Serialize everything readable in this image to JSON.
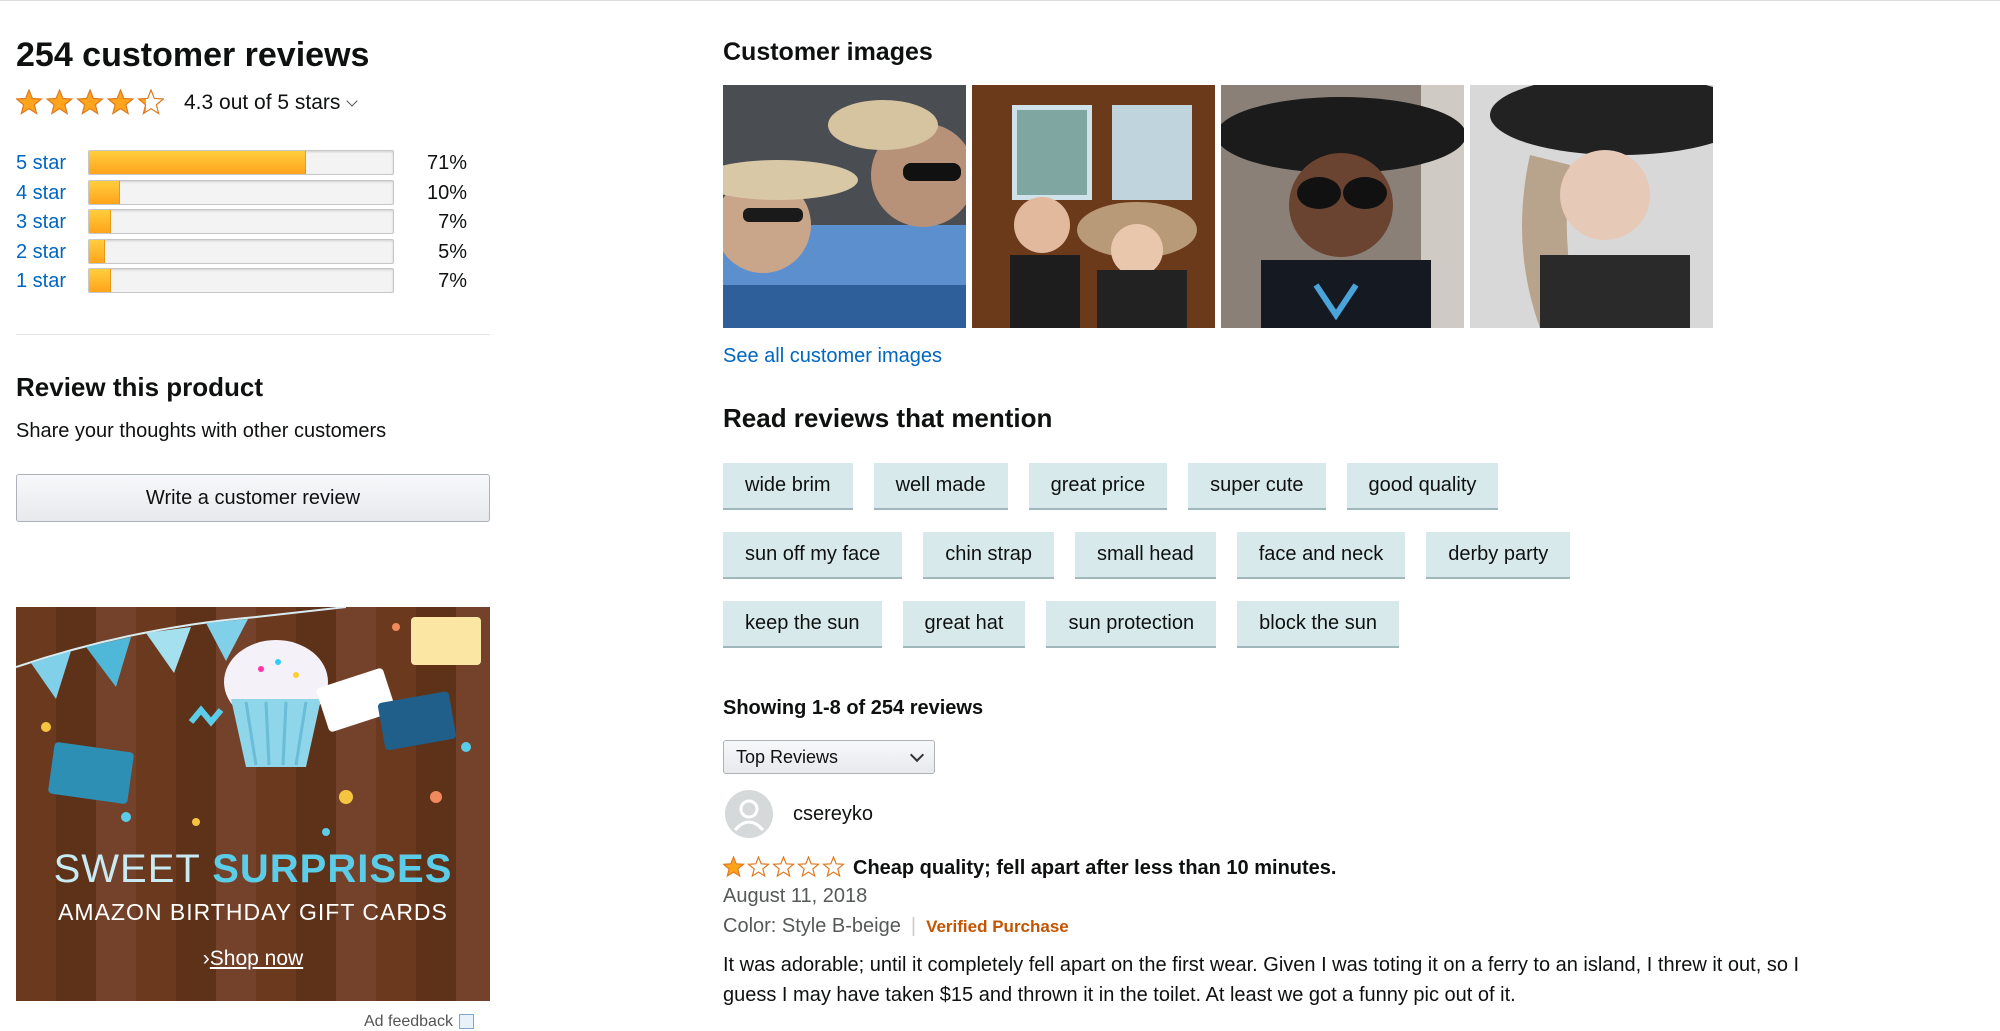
{
  "summary": {
    "review_count": "254 customer reviews",
    "rating_text": "4.3 out of 5 stars",
    "rating_value": 4.3,
    "histogram": [
      {
        "label": "5 star",
        "percent_text": "71%",
        "percent": 71
      },
      {
        "label": "4 star",
        "percent_text": "10%",
        "percent": 10
      },
      {
        "label": "3 star",
        "percent_text": "7%",
        "percent": 7
      },
      {
        "label": "2 star",
        "percent_text": "5%",
        "percent": 5
      },
      {
        "label": "1 star",
        "percent_text": "7%",
        "percent": 7
      }
    ]
  },
  "review_product": {
    "title": "Review this product",
    "subtitle": "Share your thoughts with other customers",
    "button_label": "Write a customer review"
  },
  "ad": {
    "headline_light": "SWEET ",
    "headline_bold": "SURPRISES",
    "subline": "AMAZON BIRTHDAY GIFT CARDS",
    "cta_prefix": "›",
    "cta": "Shop now",
    "feedback": "Ad feedback"
  },
  "customer_images": {
    "title": "Customer images",
    "see_all": "See all customer images"
  },
  "mentions": {
    "title": "Read reviews that mention",
    "rows": [
      [
        "wide brim",
        "well made",
        "great price",
        "super cute",
        "good quality"
      ],
      [
        "sun off my face",
        "chin strap",
        "small head",
        "face and neck",
        "derby party"
      ],
      [
        "keep the sun",
        "great hat",
        "sun protection",
        "block the sun"
      ]
    ]
  },
  "listing": {
    "showing": "Showing 1-8 of 254 reviews",
    "sort_value": "Top Reviews"
  },
  "review": {
    "author": "csereyko",
    "stars": 1,
    "title": "Cheap quality; fell apart after less than 10 minutes.",
    "date": "August 11, 2018",
    "variant": "Color: Style B-beige",
    "verified": "Verified Purchase",
    "body": "It was adorable; until it completely fell apart on the first wear. Given I was toting it on a ferry to an island, I threw it out, so I guess I may have taken $15 and thrown it in the toilet. At least we got a funny pic out of it."
  },
  "colors": {
    "link": "#0066c0",
    "star": "#ffa41c",
    "chip": "#d8e9ec",
    "verified": "#c45500"
  }
}
